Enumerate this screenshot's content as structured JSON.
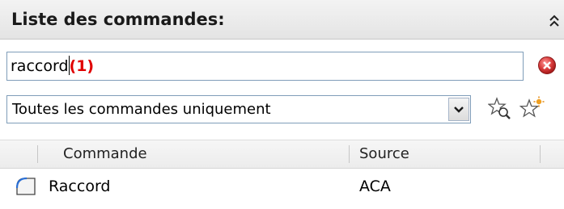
{
  "panel": {
    "title": "Liste des commandes:",
    "collapse_icon": "double-chevron-up-icon"
  },
  "search": {
    "value": "raccord",
    "result_count": "(1)",
    "clear_icon": "clear-search-icon"
  },
  "filter": {
    "selected": "Toutes les commandes uniquement",
    "dropdown_icon": "chevron-down-icon"
  },
  "toolbar": {
    "star_search_icon": "star-search-icon",
    "star_new_icon": "star-new-icon"
  },
  "table": {
    "columns": [
      "Commande",
      "Source"
    ],
    "rows": [
      {
        "icon": "fillet-icon",
        "command": "Raccord",
        "source": "ACA"
      }
    ]
  },
  "colors": {
    "accent_red": "#e00000",
    "border": "#7f9db9"
  }
}
